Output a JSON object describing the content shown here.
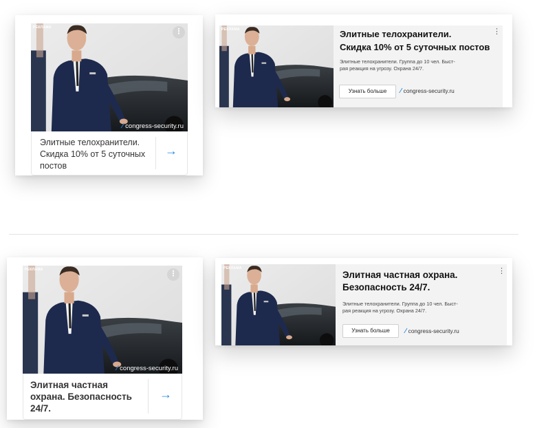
{
  "colors": {
    "accent": "#1e88e5",
    "text_dark": "#111111",
    "text_area_bg": "#f3f3f3"
  },
  "icons": {
    "arrow": "→",
    "feather": "⁄",
    "kebab": "⋮",
    "dots": "⋮"
  },
  "ads": {
    "a1": {
      "badge": "реклама",
      "domain_overlay": "congress-security.ru",
      "title": "Элитные телохранители. Скидка 10% от 5 суточных постов"
    },
    "a2": {
      "badge": "реклама",
      "title_line1": "Элитные телохранители.",
      "title_line2": "Скидка 10% от 5 суточных постов",
      "desc_line1": "Элитные телохранители. Группа до 10 чел. Быст-",
      "desc_line2": "рая реакция на угрозу. Охрана 24/7.",
      "button": "Узнать больше",
      "domain": "congress-security.ru"
    },
    "a3": {
      "badge": "реклама",
      "domain_overlay": "congress-security.ru",
      "title": "Элитная частная охрана. Безопасность 24/7."
    },
    "a4": {
      "badge": "реклама",
      "title_line1": "Элитная частная охрана.",
      "title_line2": "Безопасность 24/7.",
      "desc_line1": "Элитные телохранители. Группа до 10 чел. Быст-",
      "desc_line2": "рая реакция на угрозу. Охрана 24/7.",
      "button": "Узнать больше",
      "domain": "congress-security.ru"
    }
  }
}
